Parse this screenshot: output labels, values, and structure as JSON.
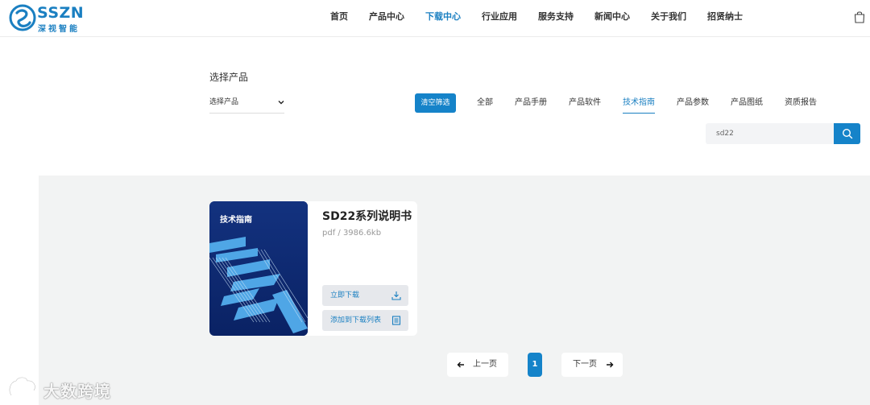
{
  "brand": {
    "name": "SSZN",
    "subtitle": "深视智能",
    "color": "#1a7fc1"
  },
  "nav": {
    "items": [
      {
        "label": "首页",
        "active": false
      },
      {
        "label": "产品中心",
        "active": false
      },
      {
        "label": "下载中心",
        "active": true
      },
      {
        "label": "行业应用",
        "active": false
      },
      {
        "label": "服务支持",
        "active": false
      },
      {
        "label": "新闻中心",
        "active": false
      },
      {
        "label": "关于我们",
        "active": false
      },
      {
        "label": "招贤纳士",
        "active": false
      }
    ],
    "cart_icon": "shopping-bag-icon"
  },
  "filter": {
    "select_title": "选择产品",
    "select_value": "选择产品",
    "clear_label": "清空筛选",
    "categories": [
      {
        "label": "全部",
        "active": false
      },
      {
        "label": "产品手册",
        "active": false
      },
      {
        "label": "产品软件",
        "active": false
      },
      {
        "label": "技术指南",
        "active": true
      },
      {
        "label": "产品参数",
        "active": false
      },
      {
        "label": "产品图纸",
        "active": false
      },
      {
        "label": "资质报告",
        "active": false
      }
    ],
    "search_value": "sd22",
    "search_icon": "search-icon",
    "accent": "#1583c9"
  },
  "results": [
    {
      "cover_label": "技术指南",
      "title": "SD22系列说明书",
      "meta": "pdf / 3986.6kb",
      "download_label": "立即下载",
      "add_label": "添加到下载列表"
    }
  ],
  "pagination": {
    "prev_label": "上一页",
    "current": "1",
    "next_label": "下一页"
  },
  "watermark": {
    "text": "大数跨境"
  }
}
